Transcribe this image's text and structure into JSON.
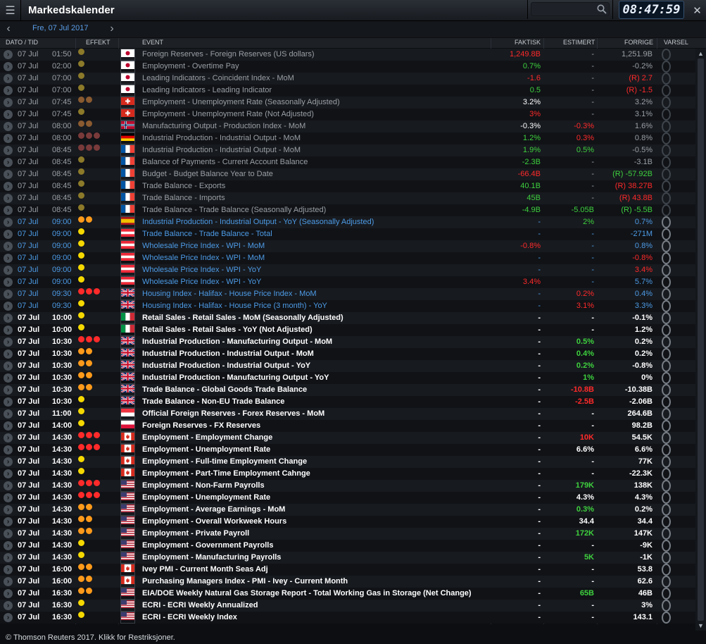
{
  "window": {
    "title": "Markedskalender",
    "clock": "08:47:59",
    "menu_icon": "menu-icon",
    "close_icon": "close-icon"
  },
  "search": {
    "placeholder": "",
    "value": ""
  },
  "nav": {
    "date_label": "Fre, 07 Jul 2017"
  },
  "columns": {
    "date_time": "DATO / TID",
    "effect": "EFFEKT",
    "event": "EVENT",
    "actual": "FAKTISK",
    "forecast": "ESTIMERT",
    "previous": "FORRIGE",
    "alert": "VARSEL"
  },
  "colors": {
    "past": "#9aa0a6",
    "today_blue": "#4d9be6",
    "upcoming": "#ffffff",
    "green": "#3ed13e",
    "red": "#ff2a2a"
  },
  "rows": [
    {
      "date": "07 Jul",
      "time": "01:50",
      "impact": 1,
      "flag": "jp",
      "event": "Foreign Reserves - Foreign Reserves (US dollars)",
      "actual": "1,249.8B",
      "actual_c": "red",
      "forecast": "-",
      "forecast_c": "",
      "previous": "1,251.9B",
      "previous_c": "",
      "state": "past"
    },
    {
      "date": "07 Jul",
      "time": "02:00",
      "impact": 1,
      "flag": "jp",
      "event": "Employment - Overtime Pay",
      "actual": "0.7%",
      "actual_c": "green",
      "forecast": "-",
      "forecast_c": "",
      "previous": "-0.2%",
      "previous_c": "",
      "state": "past"
    },
    {
      "date": "07 Jul",
      "time": "07:00",
      "impact": 1,
      "flag": "jp",
      "event": "Leading Indicators - Coincident Index - MoM",
      "actual": "-1.6",
      "actual_c": "red",
      "forecast": "-",
      "forecast_c": "",
      "previous": "(R) 2.7",
      "previous_c": "red",
      "state": "past"
    },
    {
      "date": "07 Jul",
      "time": "07:00",
      "impact": 1,
      "flag": "jp",
      "event": "Leading Indicators - Leading Indicator",
      "actual": "0.5",
      "actual_c": "green",
      "forecast": "-",
      "forecast_c": "",
      "previous": "(R) -1.5",
      "previous_c": "red",
      "state": "past"
    },
    {
      "date": "07 Jul",
      "time": "07:45",
      "impact": 2,
      "flag": "ch",
      "event": "Employment - Unemployment Rate (Seasonally Adjusted)",
      "actual": "3.2%",
      "actual_c": "white",
      "forecast": "-",
      "forecast_c": "",
      "previous": "3.2%",
      "previous_c": "",
      "state": "past"
    },
    {
      "date": "07 Jul",
      "time": "07:45",
      "impact": 1,
      "flag": "ch",
      "event": "Employment - Unemployment Rate (Not Adjusted)",
      "actual": "3%",
      "actual_c": "red",
      "forecast": "-",
      "forecast_c": "",
      "previous": "3.1%",
      "previous_c": "",
      "state": "past"
    },
    {
      "date": "07 Jul",
      "time": "08:00",
      "impact": 2,
      "flag": "no",
      "event": "Manufacturing Output - Production Index - MoM",
      "actual": "-0.3%",
      "actual_c": "white",
      "forecast": "-0.3%",
      "forecast_c": "red",
      "previous": "1.6%",
      "previous_c": "",
      "state": "past"
    },
    {
      "date": "07 Jul",
      "time": "08:00",
      "impact": 3,
      "flag": "de",
      "event": "Industrial Production - Industrial Output - MoM",
      "actual": "1.2%",
      "actual_c": "green",
      "forecast": "0.3%",
      "forecast_c": "red",
      "previous": "0.8%",
      "previous_c": "",
      "state": "past"
    },
    {
      "date": "07 Jul",
      "time": "08:45",
      "impact": 3,
      "flag": "fr",
      "event": "Industrial Production - Industrial Output - MoM",
      "actual": "1.9%",
      "actual_c": "green",
      "forecast": "0.5%",
      "forecast_c": "green",
      "previous": "-0.5%",
      "previous_c": "",
      "state": "past"
    },
    {
      "date": "07 Jul",
      "time": "08:45",
      "impact": 1,
      "flag": "fr",
      "event": "Balance of Payments - Current Account Balance",
      "actual": "-2.3B",
      "actual_c": "green",
      "forecast": "-",
      "forecast_c": "",
      "previous": "-3.1B",
      "previous_c": "",
      "state": "past"
    },
    {
      "date": "07 Jul",
      "time": "08:45",
      "impact": 1,
      "flag": "fr",
      "event": "Budget - Budget Balance Year to Date",
      "actual": "-66.4B",
      "actual_c": "red",
      "forecast": "-",
      "forecast_c": "",
      "previous": "(R) -57.92B",
      "previous_c": "green",
      "state": "past"
    },
    {
      "date": "07 Jul",
      "time": "08:45",
      "impact": 1,
      "flag": "fr",
      "event": "Trade Balance - Exports",
      "actual": "40.1B",
      "actual_c": "green",
      "forecast": "-",
      "forecast_c": "",
      "previous": "(R) 38.27B",
      "previous_c": "red",
      "state": "past"
    },
    {
      "date": "07 Jul",
      "time": "08:45",
      "impact": 1,
      "flag": "fr",
      "event": "Trade Balance - Imports",
      "actual": "45B",
      "actual_c": "green",
      "forecast": "-",
      "forecast_c": "",
      "previous": "(R) 43.8B",
      "previous_c": "red",
      "state": "past"
    },
    {
      "date": "07 Jul",
      "time": "08:45",
      "impact": 1,
      "flag": "fr",
      "event": "Trade Balance - Trade Balance (Seasonally Adjusted)",
      "actual": "-4.9B",
      "actual_c": "green",
      "forecast": "-5.05B",
      "forecast_c": "green",
      "previous": "(R) -5.5B",
      "previous_c": "green",
      "state": "past"
    },
    {
      "date": "07 Jul",
      "time": "09:00",
      "impact": 2,
      "flag": "es",
      "event": "Industrial Production - Industrial Output - YoY (Seasonally Adjusted)",
      "actual": "-",
      "actual_c": "",
      "forecast": "2%",
      "forecast_c": "green",
      "previous": "0.7%",
      "previous_c": "",
      "state": "today"
    },
    {
      "date": "07 Jul",
      "time": "09:00",
      "impact": 1,
      "flag": "at",
      "event": "Trade Balance - Trade Balance - Total",
      "actual": "-",
      "actual_c": "",
      "forecast": "-",
      "forecast_c": "",
      "previous": "-271M",
      "previous_c": "",
      "state": "today"
    },
    {
      "date": "07 Jul",
      "time": "09:00",
      "impact": 1,
      "flag": "at",
      "event": "Wholesale Price Index - WPI - MoM",
      "actual": "-0.8%",
      "actual_c": "red",
      "forecast": "-",
      "forecast_c": "",
      "previous": "0.8%",
      "previous_c": "",
      "state": "today"
    },
    {
      "date": "07 Jul",
      "time": "09:00",
      "impact": 1,
      "flag": "at",
      "event": "Wholesale Price Index - WPI - MoM",
      "actual": "-",
      "actual_c": "",
      "forecast": "-",
      "forecast_c": "",
      "previous": "-0.8%",
      "previous_c": "red",
      "state": "today"
    },
    {
      "date": "07 Jul",
      "time": "09:00",
      "impact": 1,
      "flag": "at",
      "event": "Wholesale Price Index - WPI - YoY",
      "actual": "-",
      "actual_c": "",
      "forecast": "-",
      "forecast_c": "",
      "previous": "3.4%",
      "previous_c": "red",
      "state": "today"
    },
    {
      "date": "07 Jul",
      "time": "09:00",
      "impact": 1,
      "flag": "at",
      "event": "Wholesale Price Index - WPI - YoY",
      "actual": "3.4%",
      "actual_c": "red",
      "forecast": "-",
      "forecast_c": "",
      "previous": "5.7%",
      "previous_c": "",
      "state": "today"
    },
    {
      "date": "07 Jul",
      "time": "09:30",
      "impact": 3,
      "flag": "gb",
      "event": "Housing Index - Halifax - House Price Index - MoM",
      "actual": "-",
      "actual_c": "",
      "forecast": "0.2%",
      "forecast_c": "red",
      "previous": "0.4%",
      "previous_c": "",
      "state": "today"
    },
    {
      "date": "07 Jul",
      "time": "09:30",
      "impact": 1,
      "flag": "gb",
      "event": "Housing Index - Halifax - House Price (3 month) - YoY",
      "actual": "-",
      "actual_c": "",
      "forecast": "3.1%",
      "forecast_c": "red",
      "previous": "3.3%",
      "previous_c": "",
      "state": "today"
    },
    {
      "date": "07 Jul",
      "time": "10:00",
      "impact": 1,
      "flag": "it",
      "event": "Retail Sales - Retail Sales - MoM (Seasonally Adjusted)",
      "actual": "-",
      "actual_c": "",
      "forecast": "-",
      "forecast_c": "",
      "previous": "-0.1%",
      "previous_c": "",
      "state": "upcoming"
    },
    {
      "date": "07 Jul",
      "time": "10:00",
      "impact": 1,
      "flag": "it",
      "event": "Retail Sales - Retail Sales - YoY (Not Adjusted)",
      "actual": "-",
      "actual_c": "",
      "forecast": "-",
      "forecast_c": "",
      "previous": "1.2%",
      "previous_c": "",
      "state": "upcoming"
    },
    {
      "date": "07 Jul",
      "time": "10:30",
      "impact": 3,
      "flag": "gb",
      "event": "Industrial Production - Manufacturing Output - MoM",
      "actual": "-",
      "actual_c": "",
      "forecast": "0.5%",
      "forecast_c": "green",
      "previous": "0.2%",
      "previous_c": "",
      "state": "upcoming"
    },
    {
      "date": "07 Jul",
      "time": "10:30",
      "impact": 2,
      "flag": "gb",
      "event": "Industrial Production - Industrial Output - MoM",
      "actual": "-",
      "actual_c": "",
      "forecast": "0.4%",
      "forecast_c": "green",
      "previous": "0.2%",
      "previous_c": "",
      "state": "upcoming"
    },
    {
      "date": "07 Jul",
      "time": "10:30",
      "impact": 2,
      "flag": "gb",
      "event": "Industrial Production - Industrial Output - YoY",
      "actual": "-",
      "actual_c": "",
      "forecast": "0.2%",
      "forecast_c": "green",
      "previous": "-0.8%",
      "previous_c": "",
      "state": "upcoming"
    },
    {
      "date": "07 Jul",
      "time": "10:30",
      "impact": 2,
      "flag": "gb",
      "event": "Industrial Production - Manufacturing Output - YoY",
      "actual": "-",
      "actual_c": "",
      "forecast": "1%",
      "forecast_c": "green",
      "previous": "0%",
      "previous_c": "",
      "state": "upcoming"
    },
    {
      "date": "07 Jul",
      "time": "10:30",
      "impact": 2,
      "flag": "gb",
      "event": "Trade Balance - Global Goods Trade Balance",
      "actual": "-",
      "actual_c": "",
      "forecast": "-10.8B",
      "forecast_c": "red",
      "previous": "-10.38B",
      "previous_c": "",
      "state": "upcoming"
    },
    {
      "date": "07 Jul",
      "time": "10:30",
      "impact": 1,
      "flag": "gb",
      "event": "Trade Balance - Non-EU Trade Balance",
      "actual": "-",
      "actual_c": "",
      "forecast": "-2.5B",
      "forecast_c": "red",
      "previous": "-2.06B",
      "previous_c": "",
      "state": "upcoming"
    },
    {
      "date": "07 Jul",
      "time": "11:00",
      "impact": 1,
      "flag": "sg",
      "event": "Official Foreign Reserves - Forex Reserves - MoM",
      "actual": "-",
      "actual_c": "",
      "forecast": "-",
      "forecast_c": "",
      "previous": "264.6B",
      "previous_c": "",
      "state": "upcoming"
    },
    {
      "date": "07 Jul",
      "time": "14:00",
      "impact": 1,
      "flag": "pl",
      "event": "Foreign Reserves - FX Reserves",
      "actual": "-",
      "actual_c": "",
      "forecast": "-",
      "forecast_c": "",
      "previous": "98.2B",
      "previous_c": "",
      "state": "upcoming"
    },
    {
      "date": "07 Jul",
      "time": "14:30",
      "impact": 3,
      "flag": "ca",
      "event": "Employment - Employment Change",
      "actual": "-",
      "actual_c": "",
      "forecast": "10K",
      "forecast_c": "red",
      "previous": "54.5K",
      "previous_c": "",
      "state": "upcoming"
    },
    {
      "date": "07 Jul",
      "time": "14:30",
      "impact": 3,
      "flag": "ca",
      "event": "Employment - Unemployment Rate",
      "actual": "-",
      "actual_c": "",
      "forecast": "6.6%",
      "forecast_c": "white",
      "previous": "6.6%",
      "previous_c": "",
      "state": "upcoming"
    },
    {
      "date": "07 Jul",
      "time": "14:30",
      "impact": 1,
      "flag": "ca",
      "event": "Employment - Full-time Employment Change",
      "actual": "-",
      "actual_c": "",
      "forecast": "-",
      "forecast_c": "",
      "previous": "77K",
      "previous_c": "",
      "state": "upcoming"
    },
    {
      "date": "07 Jul",
      "time": "14:30",
      "impact": 1,
      "flag": "ca",
      "event": "Employment - Part-Time Employment Cahnge",
      "actual": "-",
      "actual_c": "",
      "forecast": "-",
      "forecast_c": "",
      "previous": "-22.3K",
      "previous_c": "",
      "state": "upcoming"
    },
    {
      "date": "07 Jul",
      "time": "14:30",
      "impact": 3,
      "flag": "us",
      "event": "Employment - Non-Farm Payrolls",
      "actual": "-",
      "actual_c": "",
      "forecast": "179K",
      "forecast_c": "green",
      "previous": "138K",
      "previous_c": "",
      "state": "upcoming"
    },
    {
      "date": "07 Jul",
      "time": "14:30",
      "impact": 3,
      "flag": "us",
      "event": "Employment - Unemployment Rate",
      "actual": "-",
      "actual_c": "",
      "forecast": "4.3%",
      "forecast_c": "white",
      "previous": "4.3%",
      "previous_c": "",
      "state": "upcoming"
    },
    {
      "date": "07 Jul",
      "time": "14:30",
      "impact": 2,
      "flag": "us",
      "event": "Employment - Average Earnings - MoM",
      "actual": "-",
      "actual_c": "",
      "forecast": "0.3%",
      "forecast_c": "green",
      "previous": "0.2%",
      "previous_c": "",
      "state": "upcoming"
    },
    {
      "date": "07 Jul",
      "time": "14:30",
      "impact": 2,
      "flag": "us",
      "event": "Employment - Overall Workweek Hours",
      "actual": "-",
      "actual_c": "",
      "forecast": "34.4",
      "forecast_c": "white",
      "previous": "34.4",
      "previous_c": "",
      "state": "upcoming"
    },
    {
      "date": "07 Jul",
      "time": "14:30",
      "impact": 2,
      "flag": "us",
      "event": "Employment - Private Payroll",
      "actual": "-",
      "actual_c": "",
      "forecast": "172K",
      "forecast_c": "green",
      "previous": "147K",
      "previous_c": "",
      "state": "upcoming"
    },
    {
      "date": "07 Jul",
      "time": "14:30",
      "impact": 1,
      "flag": "us",
      "event": "Employment - Government Payrolls",
      "actual": "-",
      "actual_c": "",
      "forecast": "-",
      "forecast_c": "",
      "previous": "-9K",
      "previous_c": "",
      "state": "upcoming"
    },
    {
      "date": "07 Jul",
      "time": "14:30",
      "impact": 1,
      "flag": "us",
      "event": "Employment - Manufacturing Payrolls",
      "actual": "-",
      "actual_c": "",
      "forecast": "5K",
      "forecast_c": "green",
      "previous": "-1K",
      "previous_c": "",
      "state": "upcoming"
    },
    {
      "date": "07 Jul",
      "time": "16:00",
      "impact": 2,
      "flag": "ca",
      "event": "Ivey PMI - Current Month Seas Adj",
      "actual": "-",
      "actual_c": "",
      "forecast": "-",
      "forecast_c": "",
      "previous": "53.8",
      "previous_c": "",
      "state": "upcoming"
    },
    {
      "date": "07 Jul",
      "time": "16:00",
      "impact": 2,
      "flag": "ca",
      "event": "Purchasing Managers Index - PMI - Ivey - Current Month",
      "actual": "-",
      "actual_c": "",
      "forecast": "-",
      "forecast_c": "",
      "previous": "62.6",
      "previous_c": "",
      "state": "upcoming"
    },
    {
      "date": "07 Jul",
      "time": "16:30",
      "impact": 2,
      "flag": "us",
      "event": "EIA/DOE Weekly Natural Gas Storage Report - Total Working Gas in Storage (Net Change)",
      "actual": "-",
      "actual_c": "",
      "forecast": "65B",
      "forecast_c": "green",
      "previous": "46B",
      "previous_c": "",
      "state": "upcoming"
    },
    {
      "date": "07 Jul",
      "time": "16:30",
      "impact": 1,
      "flag": "us",
      "event": "ECRI - ECRI Weekly Annualized",
      "actual": "-",
      "actual_c": "",
      "forecast": "-",
      "forecast_c": "",
      "previous": "3%",
      "previous_c": "",
      "state": "upcoming"
    },
    {
      "date": "07 Jul",
      "time": "16:30",
      "impact": 1,
      "flag": "us",
      "event": "ECRI - ECRI Weekly Index",
      "actual": "-",
      "actual_c": "",
      "forecast": "-",
      "forecast_c": "",
      "previous": "143.1",
      "previous_c": "",
      "state": "upcoming"
    }
  ],
  "footer": {
    "text": "© Thomson Reuters 2017. Klikk for Restriksjoner."
  }
}
